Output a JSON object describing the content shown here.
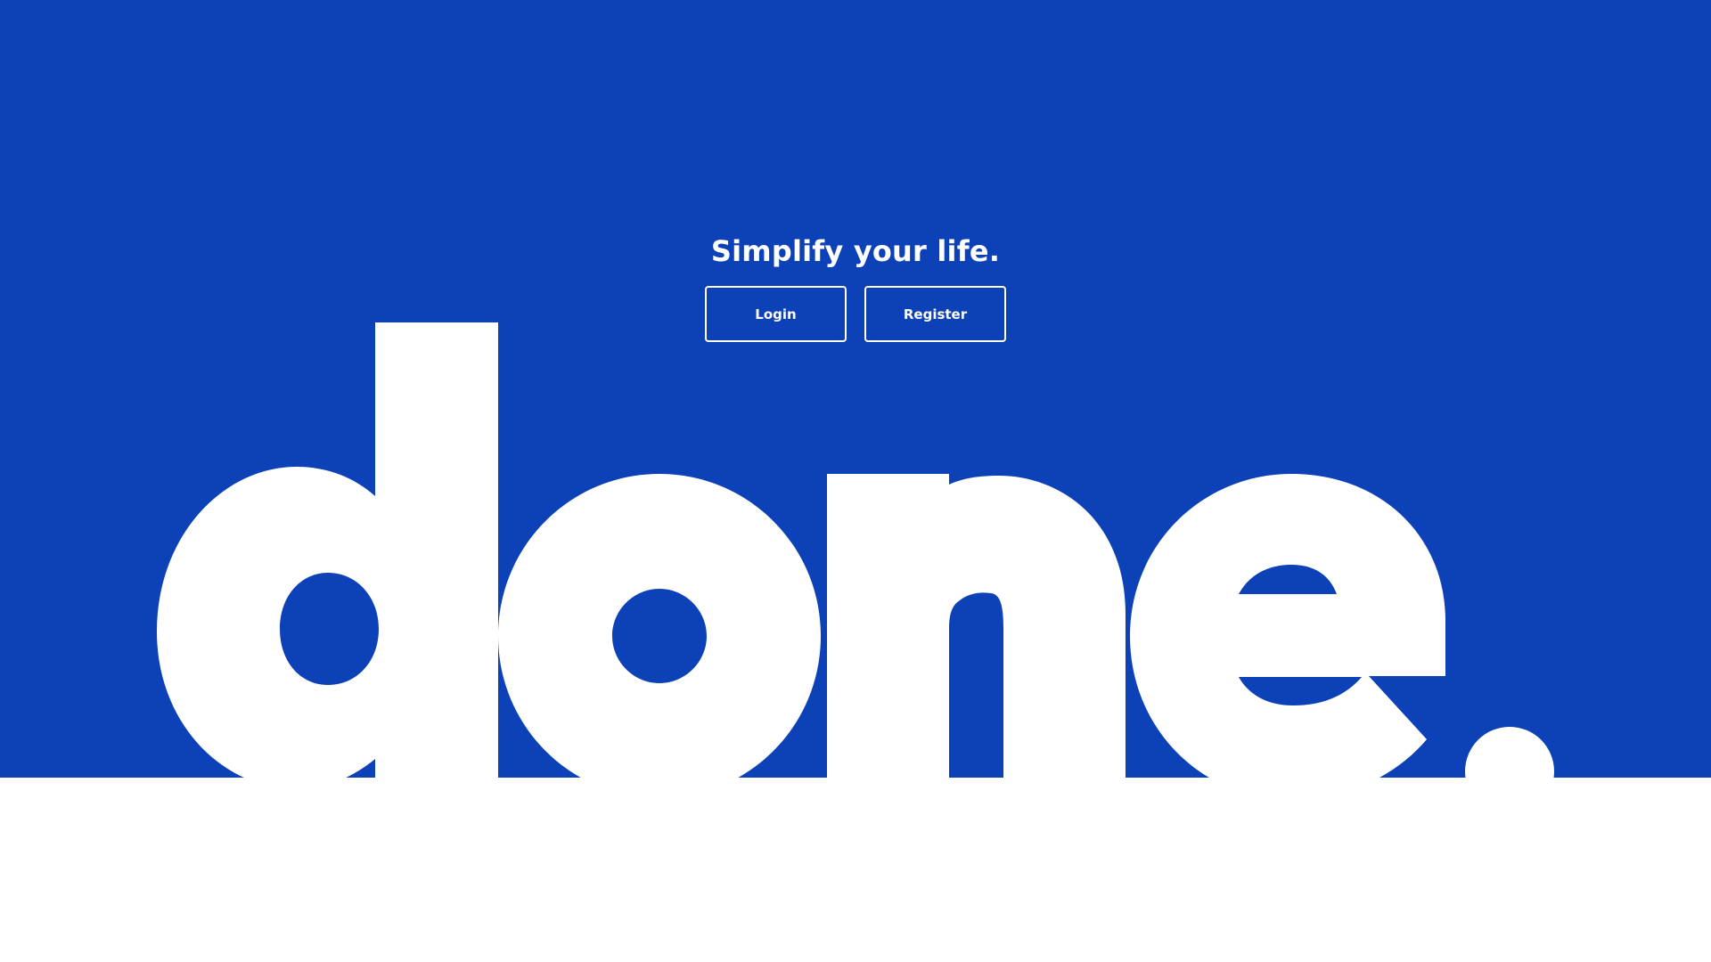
{
  "brand": {
    "wordmark": "done.",
    "primary_color": "#0d41b7",
    "text_color": "#ffffff"
  },
  "hero": {
    "tagline": "Simplify your life."
  },
  "actions": {
    "login_label": "Login",
    "register_label": "Register"
  }
}
